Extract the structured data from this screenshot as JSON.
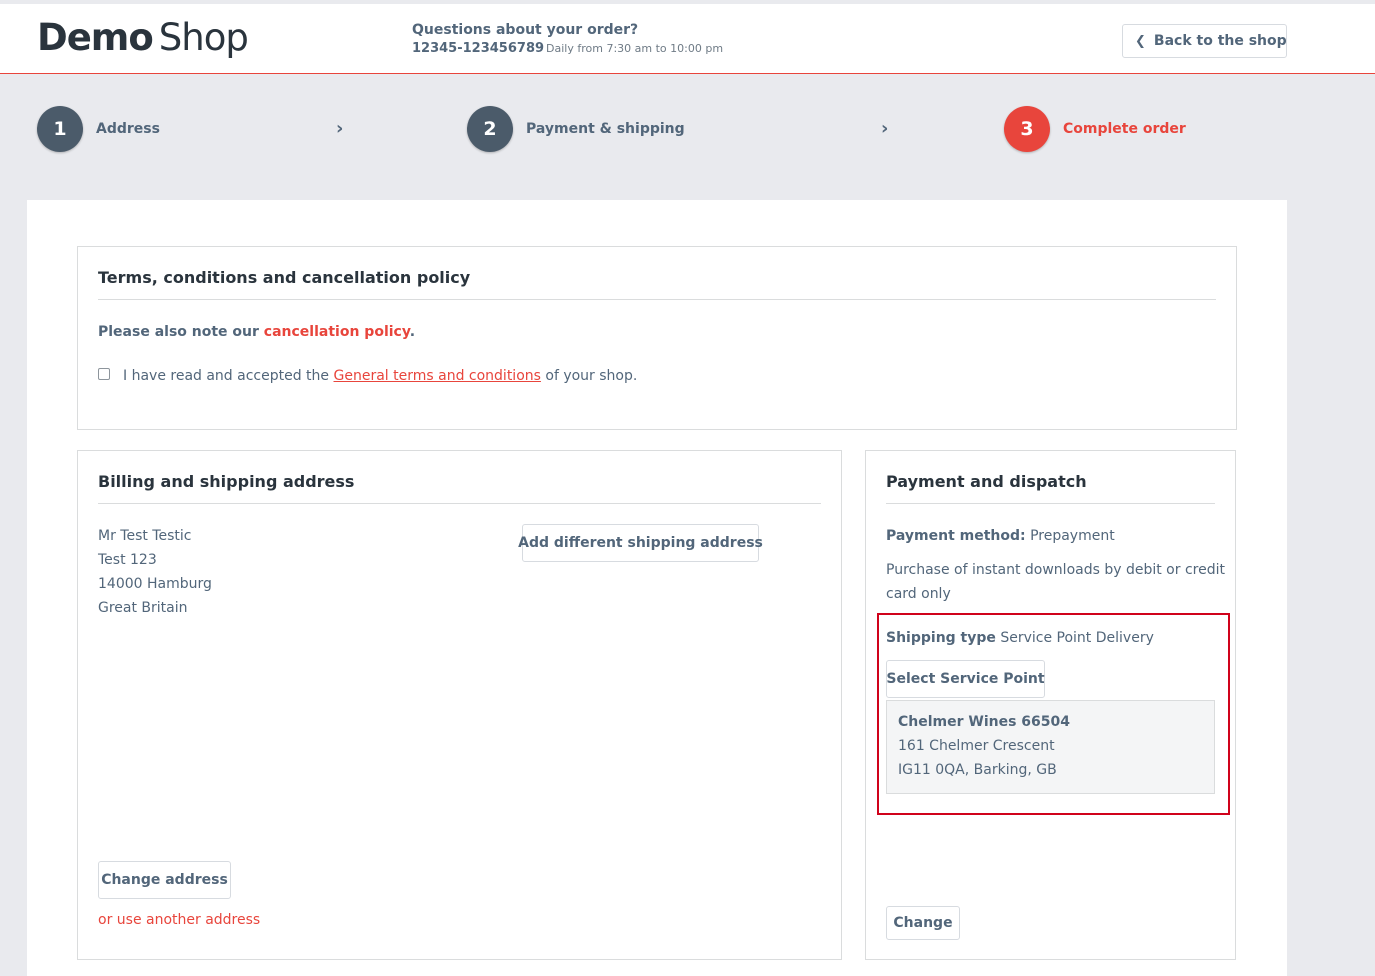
{
  "header": {
    "logo_bold": "Demo",
    "logo_light": "Shop",
    "question": "Questions about your order?",
    "phone": "12345-123456789",
    "hours": "Daily from 7:30 am to 10:00 pm",
    "back_label": "Back to the shop"
  },
  "steps": [
    {
      "number": "1",
      "label": "Address"
    },
    {
      "number": "2",
      "label": "Payment & shipping"
    },
    {
      "number": "3",
      "label": "Complete order"
    }
  ],
  "terms": {
    "title": "Terms, conditions and cancellation policy",
    "note_prefix": "Please also note our ",
    "note_link": "cancellation policy",
    "note_suffix": ".",
    "accept_prefix": "I have read and accepted the ",
    "accept_link": "General terms and conditions",
    "accept_suffix": " of your shop."
  },
  "billing": {
    "title": "Billing and shipping address",
    "address_lines": [
      "Mr Test Testic",
      "Test 123",
      "14000 Hamburg",
      "Great Britain"
    ],
    "add_shipping_label": "Add different shipping address",
    "change_label": "Change address",
    "other_label": "or use another address"
  },
  "payment": {
    "title": "Payment and dispatch",
    "method_label": "Payment method:",
    "method_value": " Prepayment",
    "note_line1": "Purchase of instant downloads by debit or credit",
    "note_line2": "card only",
    "shipping_label": "Shipping type",
    "shipping_value": " Service Point Delivery",
    "select_label": "Select Service Point",
    "service_point": {
      "name": "Chelmer Wines 66504",
      "street": "161 Chelmer Crescent",
      "city": "IG11 0QA,  Barking, GB"
    },
    "change_label": "Change"
  },
  "colors": {
    "accent": "#e8453c",
    "text": "#52667a",
    "highlight": "#d0021b"
  }
}
